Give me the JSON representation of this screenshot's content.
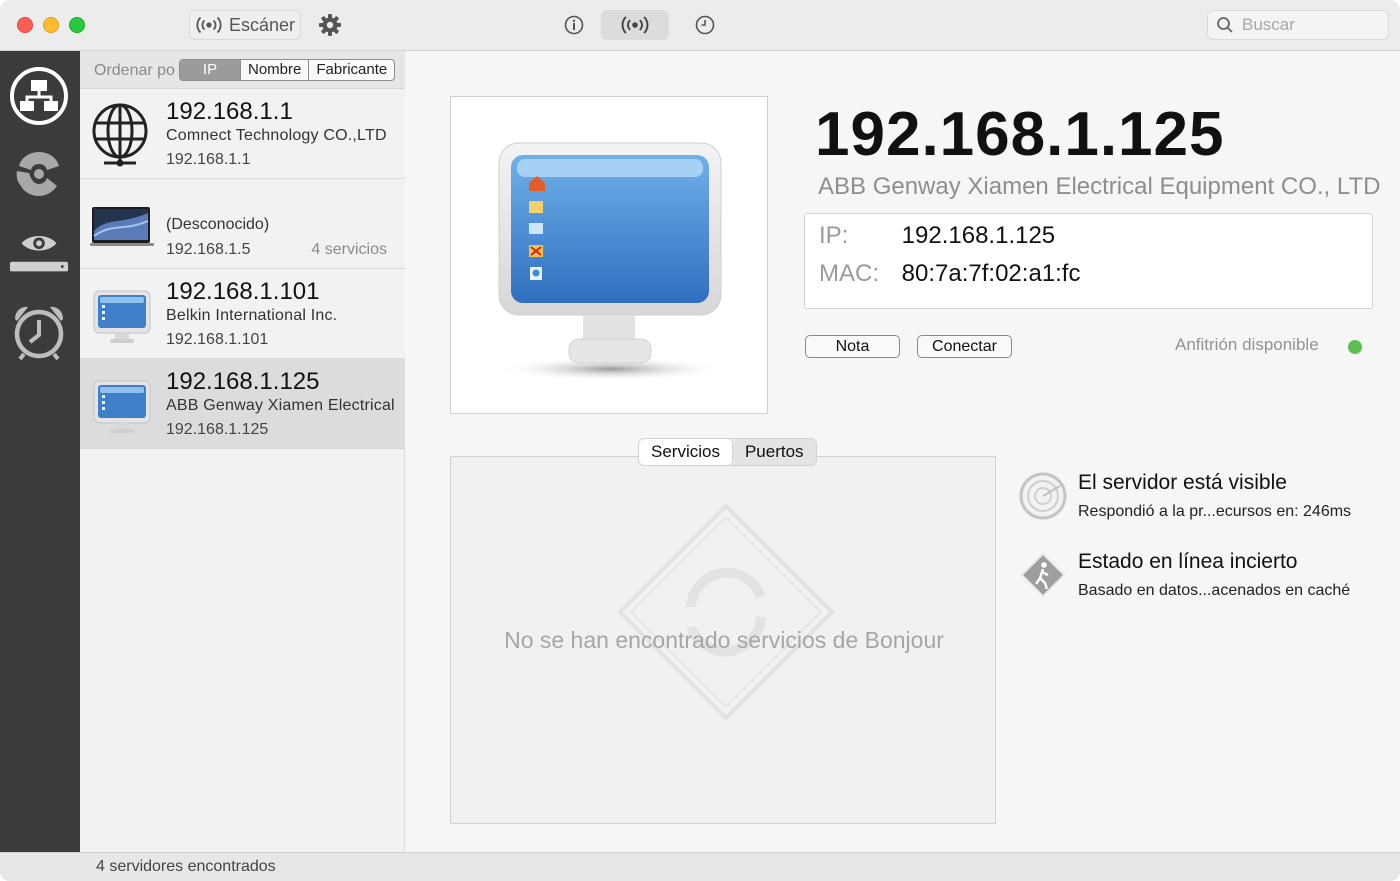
{
  "toolbar": {
    "scanner_label": "Escáner",
    "search_placeholder": "Buscar"
  },
  "sidebar": {
    "items": [
      {
        "icon": "network-icon"
      },
      {
        "icon": "radiation-icon"
      },
      {
        "icon": "eye-icon"
      },
      {
        "icon": "alarm-clock-icon"
      }
    ]
  },
  "sort": {
    "label": "Ordenar po",
    "options": [
      "IP",
      "Nombre",
      "Fabricante"
    ],
    "selected": "IP"
  },
  "devices": [
    {
      "ip": "192.168.1.1",
      "vendor": "Comnect Technology CO.,LTD",
      "ip_small": "192.168.1.1",
      "icon": "globe-icon"
    },
    {
      "name": "(Desconocido)",
      "ip_small": "192.168.1.5",
      "services": "4 servicios",
      "icon": "laptop-icon"
    },
    {
      "ip": "192.168.1.101",
      "vendor": "Belkin International Inc.",
      "ip_small": "192.168.1.101",
      "icon": "monitor-icon"
    },
    {
      "ip": "192.168.1.125",
      "vendor": "ABB Genway Xiamen Electrical",
      "ip_small": "192.168.1.125",
      "icon": "monitor-icon",
      "selected": true
    }
  ],
  "detail": {
    "ip": "192.168.1.125",
    "vendor": "ABB Genway Xiamen Electrical Equipment CO., LTD",
    "ip_label": "IP:",
    "ip_value": "192.168.1.125",
    "mac_label": "MAC:",
    "mac_value": "80:7a:7f:02:a1:fc",
    "note_button": "Nota",
    "connect_button": "Conectar",
    "availability": "Anfitrión disponible",
    "availability_color": "#5bbf4f"
  },
  "tabs": {
    "services": "Servicios",
    "ports": "Puertos",
    "selected": "Servicios"
  },
  "services": {
    "empty_message": "No se han encontrado servicios de Bonjour"
  },
  "status_items": [
    {
      "title": "El servidor está visible",
      "subtitle": "Respondió a la pr...ecursos en: 246ms"
    },
    {
      "title": "Estado en línea incierto",
      "subtitle": "Basado en datos...acenados en caché"
    }
  ],
  "statusbar": {
    "text": "4 servidores encontrados"
  }
}
